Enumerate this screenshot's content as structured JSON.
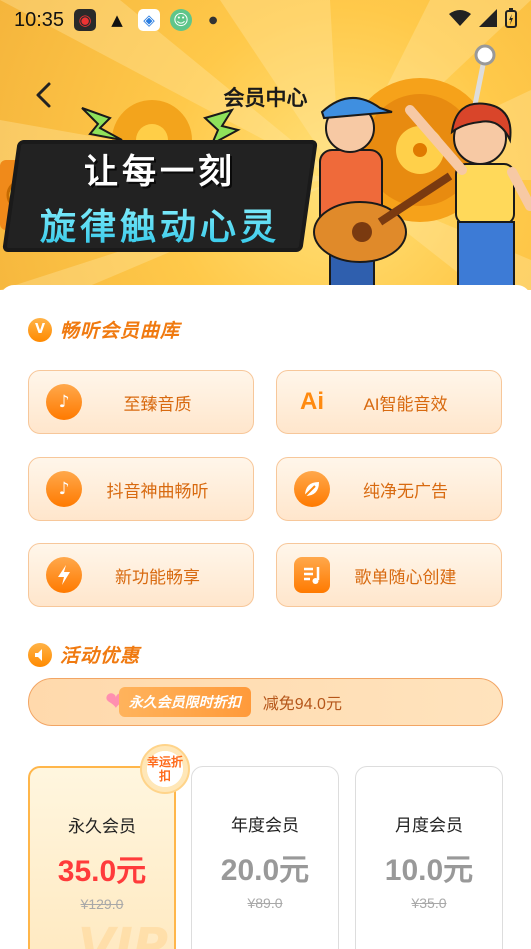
{
  "status_bar": {
    "time": "10:35"
  },
  "header": {
    "title": "会员中心"
  },
  "banner": {
    "slogan_line1": "让每一刻",
    "slogan_line2": "旋律触动心灵"
  },
  "library": {
    "badge": "V",
    "title": "畅听会员曲库",
    "features": [
      {
        "label": "至臻音质",
        "icon": "music-note-icon"
      },
      {
        "label": "AI智能音效",
        "icon": "ai-icon"
      },
      {
        "label": "抖音神曲畅听",
        "icon": "tiktok-icon"
      },
      {
        "label": "纯净无广告",
        "icon": "leaf-icon"
      },
      {
        "label": "新功能畅享",
        "icon": "lightning-icon"
      },
      {
        "label": "歌单随心创建",
        "icon": "playlist-icon"
      }
    ]
  },
  "promotions": {
    "title": "活动优惠",
    "banner_tag": "永久会员限时折扣",
    "banner_discount": "减免94.0元"
  },
  "plans": [
    {
      "name": "永久会员",
      "price": "35.0元",
      "original": "¥129.0",
      "badge": "幸运折扣",
      "selected": true
    },
    {
      "name": "年度会员",
      "price": "20.0元",
      "original": "¥89.0",
      "selected": false
    },
    {
      "name": "月度会员",
      "price": "10.0元",
      "original": "¥35.0",
      "selected": false
    }
  ],
  "colors": {
    "accent": "#ff8a00",
    "price_selected": "#ff3b3b",
    "banner_bg": "#ffc94a"
  }
}
